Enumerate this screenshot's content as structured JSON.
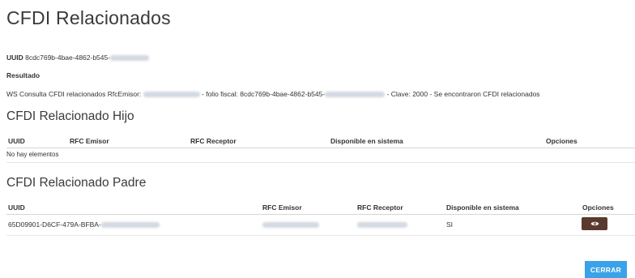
{
  "page": {
    "title": "CFDI Relacionados"
  },
  "uuid_line": {
    "label": "UUID",
    "value": "8cdc769b-4bae-4862-b545-"
  },
  "result": {
    "label": "Resultado",
    "text_a": "WS Consulta CFDI relacionados RfcEmisor:",
    "text_b": "- folio fiscal: 8cdc769b-4bae-4862-b545-",
    "text_c": "- Clave: 2000 - Se encontraron CFDI relacionados"
  },
  "hijo": {
    "title": "CFDI Relacionado Hijo",
    "columns": [
      "UUID",
      "RFC Emisor",
      "RFC Receptor",
      "Disponible en sistema",
      "Opciones"
    ],
    "empty_text": "No hay elementos"
  },
  "padre": {
    "title": "CFDI Relacionado Padre",
    "columns": [
      "UUID",
      "RFC Emisor",
      "RFC Receptor",
      "Disponible en sistema",
      "Opciones"
    ],
    "rows": [
      {
        "uuid": "65D09901-D6CF-479A-BFBA-",
        "disponible": "SI",
        "view_icon": "eye-icon"
      }
    ]
  },
  "footer": {
    "close_label": "CERRAR"
  },
  "colors": {
    "accent": "#3aa2e8",
    "view_button": "#5a3a2e",
    "redaction": "#cfd6de"
  }
}
